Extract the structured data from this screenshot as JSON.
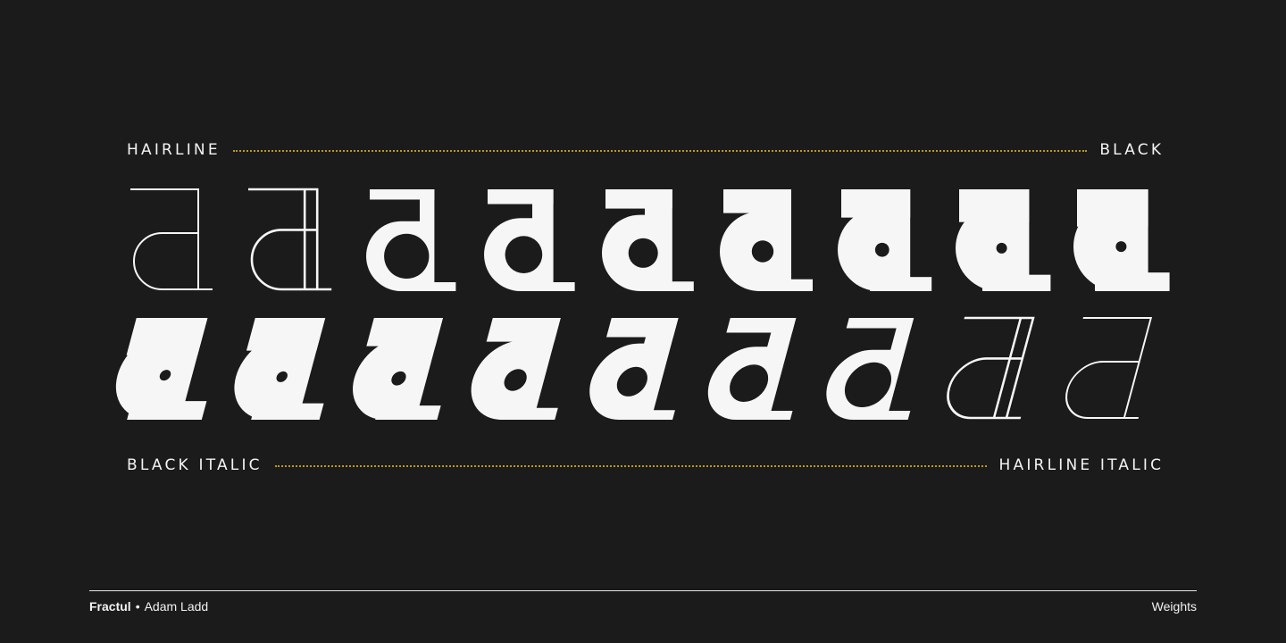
{
  "labels": {
    "top_left": "HAIRLINE",
    "top_right": "BLACK",
    "bottom_left": "BLACK ITALIC",
    "bottom_right": "HAIRLINE ITALIC"
  },
  "specimen": {
    "glyph": "a",
    "upright_weights": [
      1,
      2,
      3,
      4,
      5,
      6,
      7,
      8,
      9
    ],
    "italic_weights": [
      9,
      8,
      7,
      6,
      5,
      4,
      3,
      2,
      1
    ]
  },
  "footer": {
    "brand": "Fractul",
    "separator": "•",
    "author": "Adam Ladd",
    "section": "Weights"
  },
  "colors": {
    "background": "#1b1b1b",
    "foreground": "#f6f6f6",
    "dotted_leader": "#b99a1e",
    "rule": "#e6e6e6"
  }
}
